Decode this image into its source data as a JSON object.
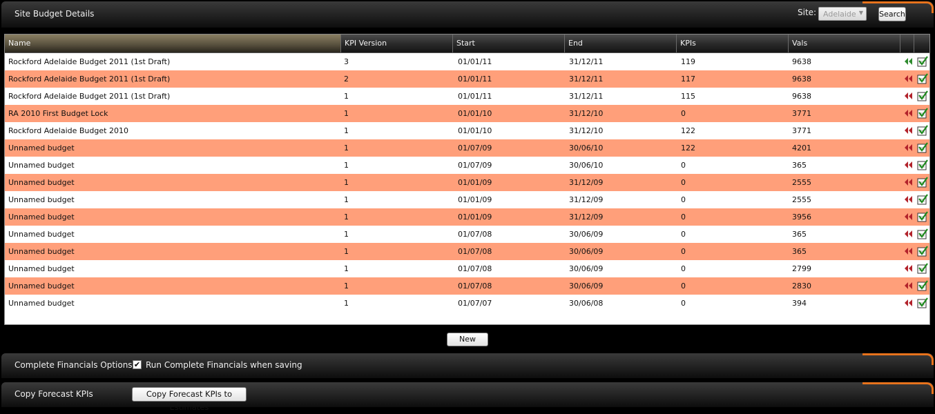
{
  "header": {
    "title": "Site Budget Details",
    "site_label": "Site:",
    "site_value": "Adelaide",
    "search_label": "Search"
  },
  "table": {
    "columns": [
      "Name",
      "KPI Version",
      "Start",
      "End",
      "KPIs",
      "Vals",
      "",
      ""
    ],
    "rows": [
      {
        "name": "Rockford Adelaide Budget 2011 (1st Draft)",
        "kpi_version": "3",
        "start": "01/01/11",
        "end": "31/12/11",
        "kpis": "119",
        "vals": "9638",
        "active": true
      },
      {
        "name": "Rockford Adelaide Budget 2011 (1st Draft)",
        "kpi_version": "2",
        "start": "01/01/11",
        "end": "31/12/11",
        "kpis": "117",
        "vals": "9638",
        "active": false
      },
      {
        "name": "Rockford Adelaide Budget 2011 (1st Draft)",
        "kpi_version": "1",
        "start": "01/01/11",
        "end": "31/12/11",
        "kpis": "115",
        "vals": "9638",
        "active": false
      },
      {
        "name": "RA 2010 First Budget Lock",
        "kpi_version": "1",
        "start": "01/01/10",
        "end": "31/12/10",
        "kpis": "0",
        "vals": "3771",
        "active": false
      },
      {
        "name": "Rockford Adelaide Budget 2010",
        "kpi_version": "1",
        "start": "01/01/10",
        "end": "31/12/10",
        "kpis": "122",
        "vals": "3771",
        "active": false
      },
      {
        "name": "Unnamed budget",
        "kpi_version": "1",
        "start": "01/07/09",
        "end": "30/06/10",
        "kpis": "122",
        "vals": "4201",
        "active": false
      },
      {
        "name": "Unnamed budget",
        "kpi_version": "1",
        "start": "01/07/09",
        "end": "30/06/10",
        "kpis": "0",
        "vals": "365",
        "active": false
      },
      {
        "name": "Unnamed budget",
        "kpi_version": "1",
        "start": "01/01/09",
        "end": "31/12/09",
        "kpis": "0",
        "vals": "2555",
        "active": false
      },
      {
        "name": "Unnamed budget",
        "kpi_version": "1",
        "start": "01/01/09",
        "end": "31/12/09",
        "kpis": "0",
        "vals": "2555",
        "active": false
      },
      {
        "name": "Unnamed budget",
        "kpi_version": "1",
        "start": "01/01/09",
        "end": "31/12/09",
        "kpis": "0",
        "vals": "3956",
        "active": false
      },
      {
        "name": "Unnamed budget",
        "kpi_version": "1",
        "start": "01/07/08",
        "end": "30/06/09",
        "kpis": "0",
        "vals": "365",
        "active": false
      },
      {
        "name": "Unnamed budget",
        "kpi_version": "1",
        "start": "01/07/08",
        "end": "30/06/09",
        "kpis": "0",
        "vals": "365",
        "active": false
      },
      {
        "name": "Unnamed budget",
        "kpi_version": "1",
        "start": "01/07/08",
        "end": "30/06/09",
        "kpis": "0",
        "vals": "2799",
        "active": false
      },
      {
        "name": "Unnamed budget",
        "kpi_version": "1",
        "start": "01/07/08",
        "end": "30/06/09",
        "kpis": "0",
        "vals": "2830",
        "active": false
      },
      {
        "name": "Unnamed budget",
        "kpi_version": "1",
        "start": "01/07/07",
        "end": "30/06/08",
        "kpis": "0",
        "vals": "394",
        "active": false
      }
    ]
  },
  "new_button_label": "New",
  "complete_financials": {
    "title": "Complete Financials Options",
    "checkbox_label": "Run Complete Financials when saving",
    "checked": true
  },
  "copy_forecast": {
    "title": "Copy Forecast KPIs",
    "button_label": "Copy Forecast KPIs to Estimates"
  },
  "colors": {
    "alt_row": "#ff9f7a",
    "accent": "#e8731c",
    "revert_active": "#2e8b2e",
    "revert_inactive": "#b2222b"
  },
  "icons": {
    "row_revert": "revert-icon",
    "row_activate": "checklist-icon"
  }
}
